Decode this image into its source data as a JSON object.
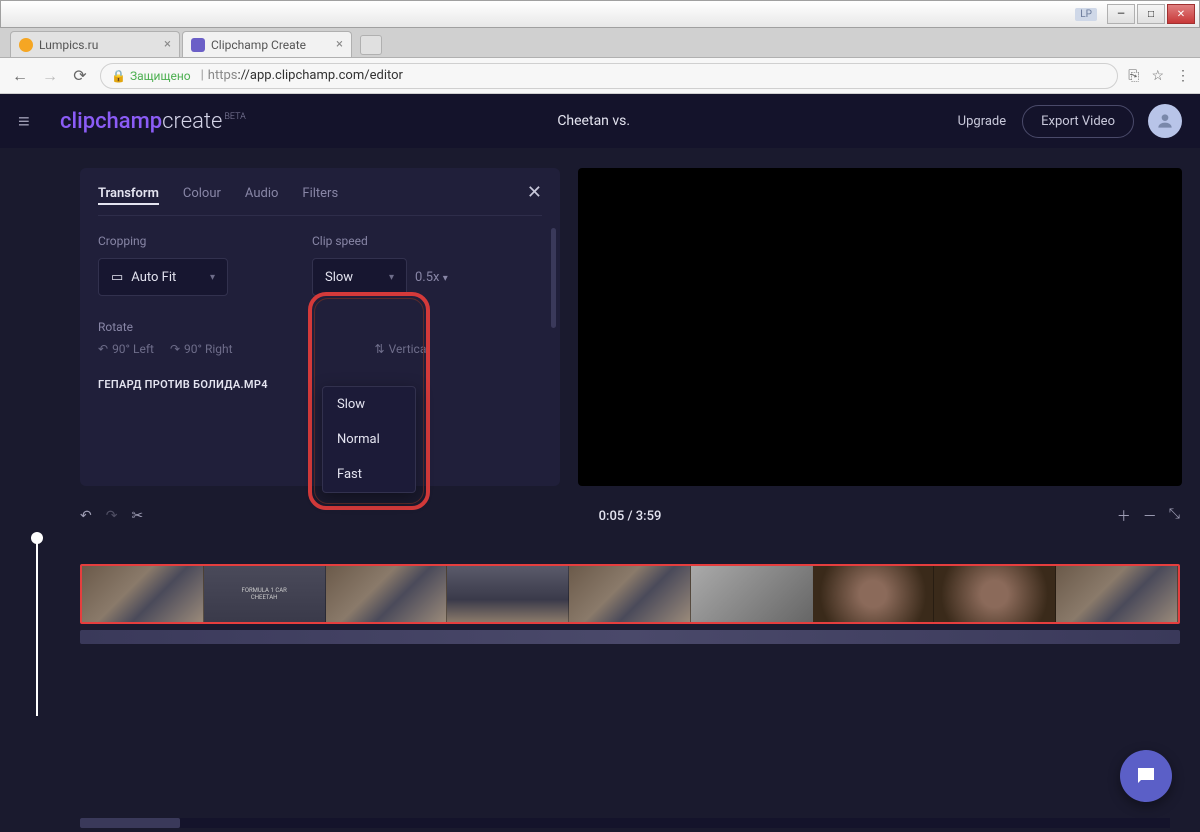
{
  "window": {
    "badge": "LP"
  },
  "tabs": [
    {
      "title": "Lumpics.ru",
      "favColor": "#f5a623"
    },
    {
      "title": "Clipchamp Create",
      "favColor": "#6b5fc7"
    }
  ],
  "address": {
    "secure": "Защищено",
    "proto": "https",
    "url": "://app.clipchamp.com/editor"
  },
  "header": {
    "logoA": "clipchamp",
    "logoB": "create",
    "beta": "BETA",
    "project": "Cheetan vs.",
    "upgrade": "Upgrade",
    "export": "Export Video"
  },
  "panel": {
    "tabs": {
      "transform": "Transform",
      "colour": "Colour",
      "audio": "Audio",
      "filters": "Filters"
    },
    "cropping_label": "Cropping",
    "cropping_value": "Auto Fit",
    "clipspeed_label": "Clip speed",
    "clipspeed_value": "Slow",
    "speed_mult": "0.5x",
    "rotate_label": "Rotate",
    "rotate_left": "90° Left",
    "rotate_right": "90° Right",
    "flip_vertical": "Vertical",
    "filename": "ГЕПАРД ПРОТИВ БОЛИДА.MP4",
    "dropdown": {
      "slow": "Slow",
      "normal": "Normal",
      "fast": "Fast"
    }
  },
  "timeline": {
    "time": "0:05 / 3:59"
  }
}
